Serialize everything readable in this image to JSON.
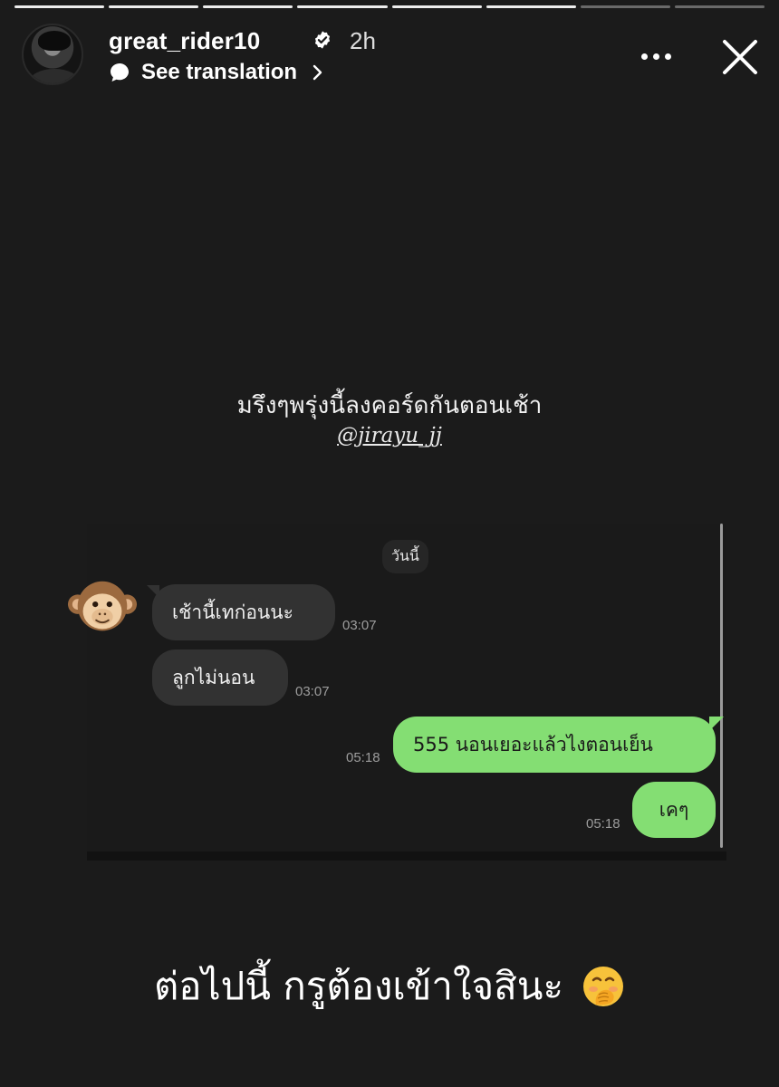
{
  "story": {
    "progress_total": 8,
    "progress_done": 6,
    "username": "great_rider10",
    "time_ago": "2h",
    "translate_label": "See translation",
    "verified_color": "#ffffff"
  },
  "caption_top": "มรึงๆพรุ่งนี้ลงคอร์ดกันตอนเช้า",
  "mention": "@jirayu_jj",
  "chat": {
    "date_label": "วันนี้",
    "messages": [
      {
        "side": "in",
        "text": "เช้านี้เทก่อนนะ",
        "time": "03:07"
      },
      {
        "side": "in",
        "text": "ลูกไม่นอน",
        "time": "03:07"
      },
      {
        "side": "out",
        "text": "555 นอนเยอะแล้วไงตอนเย็น",
        "time": "05:18"
      },
      {
        "side": "out",
        "text": "เคๆ",
        "time": "05:18"
      }
    ],
    "colors": {
      "incoming": "#323232",
      "outgoing": "#84de73"
    }
  },
  "caption_bottom": "ต่อไปนี้ กรูต้องเข้าใจสินะ",
  "icons": [
    "verified-badge-icon",
    "translate-bubble-icon",
    "chevron-right-icon",
    "more-options-icon",
    "close-icon",
    "monkey-emoji-icon",
    "hand-over-mouth-emoji-icon"
  ]
}
